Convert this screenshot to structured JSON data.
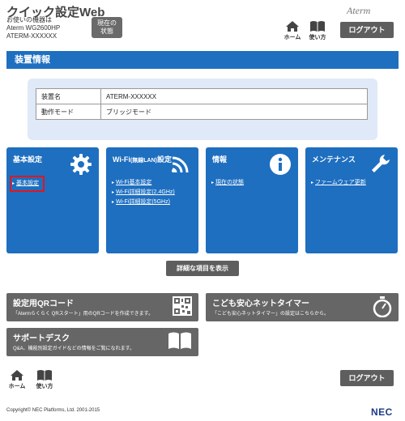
{
  "header": {
    "title": "クイック設定Web",
    "device_line1": "お使いの機器は",
    "device_line2": "Aterm WG2600HP",
    "device_line3": "ATERM-XXXXXX",
    "status_button": "現在の\n状態",
    "brand": "Aterm",
    "home_label": "ホーム",
    "help_label": "使い方",
    "logout_label": "ログアウト"
  },
  "section": {
    "title": "装置情報"
  },
  "info_table": [
    {
      "key": "装置名",
      "value": "ATERM-XXXXXX"
    },
    {
      "key": "動作モード",
      "value": "ブリッジモード"
    }
  ],
  "cards": {
    "basic": {
      "title": "基本設定",
      "icon": "gear-icon",
      "links": [
        "基本設定"
      ]
    },
    "wifi": {
      "title_main": "Wi-Fi",
      "title_small": "(無線LAN)",
      "title_tail": "設定",
      "icon": "wifi-icon",
      "links": [
        "Wi-Fi基本設定",
        "Wi-Fi詳細設定(2.4GHz)",
        "Wi-Fi詳細設定(5GHz)"
      ]
    },
    "info": {
      "title": "情報",
      "icon": "info-icon",
      "links": [
        "現在の状態"
      ]
    },
    "maintenance": {
      "title": "メンテナンス",
      "icon": "wrench-icon",
      "links": [
        "ファームウェア更新"
      ]
    }
  },
  "detail_button": "詳細な項目を表示",
  "banners": {
    "qr": {
      "title": "設定用QRコード",
      "desc": "「Atermらくらく QRスタート」用のQRコードを作成できます。",
      "icon": "qr-code-icon"
    },
    "timer": {
      "title": "こども安心ネットタイマー",
      "desc": "「こども安心ネットタイマー」の設定はこちらから。",
      "icon": "stopwatch-icon"
    },
    "support": {
      "title": "サポートデスク",
      "desc": "Q&A、機能別設定ガイドなどの情報をご覧になれます。",
      "icon": "book-icon"
    }
  },
  "footer": {
    "home_label": "ホーム",
    "help_label": "使い方",
    "logout_label": "ログアウト",
    "copyright": "Copyright© NEC Platforms, Ltd. 2001-2015",
    "nec_logo": "NEC"
  },
  "colors": {
    "accent_blue": "#1e6fc0",
    "button_gray": "#5e5e5e",
    "banner_gray": "#666666",
    "highlight_red": "#e0171f",
    "info_box_bg": "#dfe9f8"
  }
}
